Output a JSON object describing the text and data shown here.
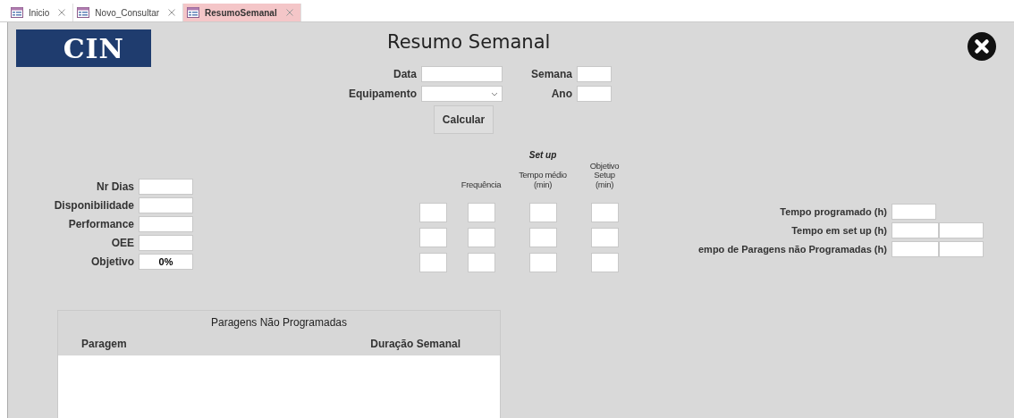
{
  "tabs": [
    {
      "label": "Inicio",
      "selected": false
    },
    {
      "label": "Novo_Consultar",
      "selected": false
    },
    {
      "label": "ResumoSemanal",
      "selected": true
    }
  ],
  "logo": {
    "text": "CIN"
  },
  "title": "Resumo Semanal",
  "filters": [
    {
      "label": "Data",
      "kind": "text"
    },
    {
      "label": "Semana",
      "kind": "text"
    },
    {
      "label": "Equipamento",
      "kind": "combo"
    },
    {
      "label": "Ano",
      "kind": "text"
    }
  ],
  "calculate_button": "Calcular",
  "indicators": [
    {
      "label": "Nr Dias"
    },
    {
      "label": "Disponibilidade"
    },
    {
      "label": "Performance"
    },
    {
      "label": "OEE"
    },
    {
      "label": "Objetivo",
      "value": "0%"
    }
  ],
  "setup": {
    "title": "Set up",
    "columns": [
      {
        "kind": "blank"
      },
      {
        "kind": "header",
        "label": "Frequência"
      },
      {
        "kind": "header",
        "label": "Tempo médio\n(min)"
      },
      {
        "kind": "header",
        "label": "Objetivo Setup\n(min)"
      }
    ],
    "rows": [
      {
        "kind": "input_row"
      },
      {
        "kind": "input_row"
      },
      {
        "kind": "input_row"
      }
    ]
  },
  "totals": [
    {
      "label": "Tempo programado (h)",
      "kind": "single"
    },
    {
      "label": "Tempo em set up (h)",
      "kind": "double"
    },
    {
      "label": "empo de Paragens não Programadas (h)",
      "kind": "double"
    }
  ],
  "table": {
    "title": "Paragens Não Programadas",
    "columns": [
      "Paragem",
      "Duração Semanal"
    ]
  }
}
